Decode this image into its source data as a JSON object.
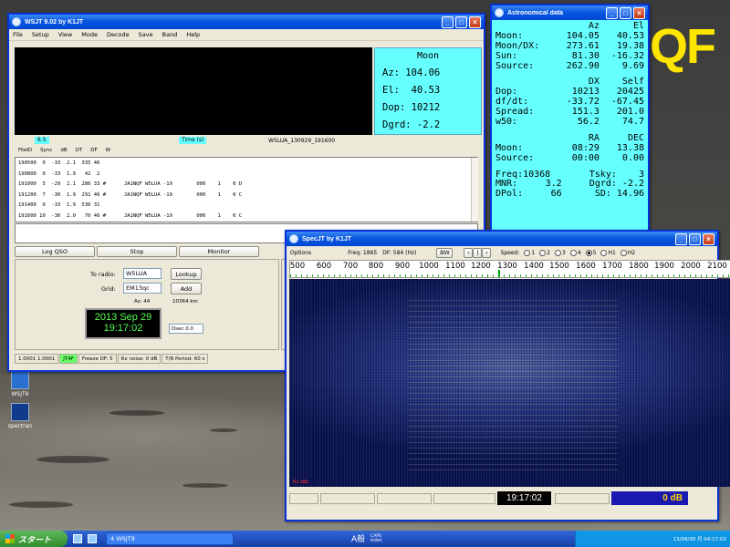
{
  "desktop": {
    "icons": [
      {
        "label": "WSJT9",
        "icon": "wsjt-icon"
      },
      {
        "label": "spectran",
        "icon": "spectran-icon"
      }
    ]
  },
  "wsjt": {
    "title": "WSJT 9.02    by K1JT",
    "menu": [
      "File",
      "Setup",
      "View",
      "Mode",
      "Decode",
      "Save",
      "Band",
      "Help"
    ],
    "moon_panel": {
      "title": "Moon",
      "az": "Az: 104.06",
      "el": "El:  40.53",
      "dop": "Dop: 10212",
      "dgrd": "Dgrd: -2.2"
    },
    "tag_left": "6.5",
    "tag_mid": "Time (s)",
    "filename": "W5LUA_130929_191600",
    "decode_header": [
      "FileID",
      "Sync",
      "dB",
      "DT",
      "DF",
      "W"
    ],
    "decode_lines": [
      "190500  0  -33  2.1  335 46",
      "190800  0  -33  1.9   42  2",
      "191000  5  -29  2.1  286 33 #      JA1NQF W5LUA -19        000    1    0 D",
      "191200  7  -30  1.9  291 46 #      JA1NQF W5LUA -19        000    1    0 C",
      "191400  0  -33  1.9  536 31",
      "191600 10  -30  2.0   70 46 #      JA1NQF W5LUA -19        000    1    0 C"
    ],
    "buttons": [
      "Log QSO",
      "Stop",
      "Monitor"
    ],
    "to_radio_label": "To radio:",
    "to_radio": "W5LUA",
    "grid_label": "Grid:",
    "grid": "EM13qc",
    "lookup": "Lookup",
    "add": "Add",
    "az_info": "Az: 44",
    "dist_info": "10364 km",
    "date": "2013 Sep 29",
    "time": "19:17:02",
    "dsec": "Dsec  0.0",
    "status": [
      "1.0001  1.0001",
      "JT4F",
      "Freeze DF:  5",
      "Rx noise:  0 dB",
      "T/R Period: 60 s"
    ],
    "mode_color": "#66ff66"
  },
  "astro": {
    "title": "Astronomical data",
    "rows1": [
      {
        "k": "",
        "v1": "Az",
        "v2": "El"
      },
      {
        "k": "Moon:",
        "v1": "104.05",
        "v2": "40.53"
      },
      {
        "k": "Moon/DX:",
        "v1": "273.61",
        "v2": "19.38"
      },
      {
        "k": "Sun:",
        "v1": "81.30",
        "v2": "-16.32"
      },
      {
        "k": "Source:",
        "v1": "262.90",
        "v2": "9.69"
      }
    ],
    "rows2": [
      {
        "k": "",
        "v1": "DX",
        "v2": "Self"
      },
      {
        "k": "Dop:",
        "v1": "10213",
        "v2": "20425"
      },
      {
        "k": "df/dt:",
        "v1": "-33.72",
        "v2": "-67.45"
      },
      {
        "k": "Spread:",
        "v1": "151.3",
        "v2": "201.0"
      },
      {
        "k": "w50:",
        "v1": "56.2",
        "v2": "74.7"
      }
    ],
    "rows3": [
      {
        "k": "",
        "v1": "RA",
        "v2": "DEC"
      },
      {
        "k": "Moon:",
        "v1": "08:29",
        "v2": "13.38"
      },
      {
        "k": "Source:",
        "v1": "00:00",
        "v2": "0.00"
      }
    ],
    "rows4": [
      {
        "k": "Freq:10368",
        "v1": "",
        "v2": "Tsky:    3"
      },
      {
        "k": "MNR:",
        "v1": "3.2",
        "v2": "Dgrd: -2.2"
      },
      {
        "k": "DPol:",
        "v1": "66",
        "v2": "SD: 14.96"
      }
    ]
  },
  "specjt": {
    "title": "SpecJT    by K1JT",
    "options": "Options",
    "freq": "Freq:  1865",
    "df": "DF:  584  (Hz)",
    "bw": "BW",
    "speed_label": "Speed:",
    "speeds": [
      "1",
      "2",
      "3",
      "4",
      "5",
      "H1",
      "H2"
    ],
    "scale": [
      "500",
      "600",
      "700",
      "800",
      "900",
      "1000",
      "1100",
      "1200",
      "1300",
      "1400",
      "1500",
      "1600",
      "1700",
      "1800",
      "1900",
      "2000",
      "2100"
    ],
    "time": "19:17:02",
    "db": "0 dB",
    "overlay_label": "Rx dBc"
  },
  "taskbar": {
    "start": "スタート",
    "task": "4 WSJT9",
    "clock": "13/09/30 月 04:17:02",
    "ime": "A般",
    "caps": "CAPS\nKANA"
  },
  "overlay": {
    "letters": "QF"
  }
}
